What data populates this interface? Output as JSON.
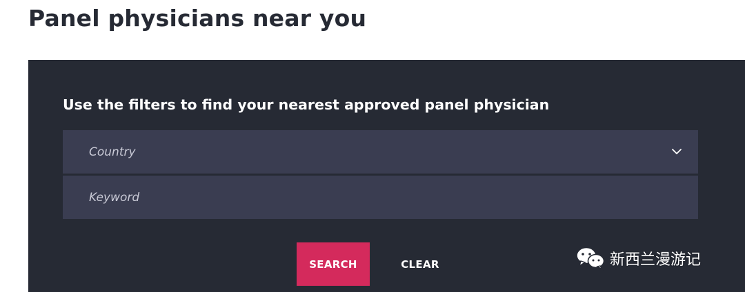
{
  "page": {
    "title": "Panel physicians near you"
  },
  "filters": {
    "heading": "Use the filters to find your nearest approved panel physician",
    "country": {
      "placeholder": "Country",
      "icon": "chevron-down-icon"
    },
    "keyword": {
      "placeholder": "Keyword"
    },
    "search_label": "SEARCH",
    "clear_label": "CLEAR"
  },
  "watermark": {
    "icon": "wechat-icon",
    "text": "新西兰漫游记"
  },
  "colors": {
    "title_text": "#262a34",
    "panel_bg": "#262a34",
    "field_bg": "#3a3d51",
    "search_bg": "#d42a5c",
    "text_light": "#ffffff"
  }
}
